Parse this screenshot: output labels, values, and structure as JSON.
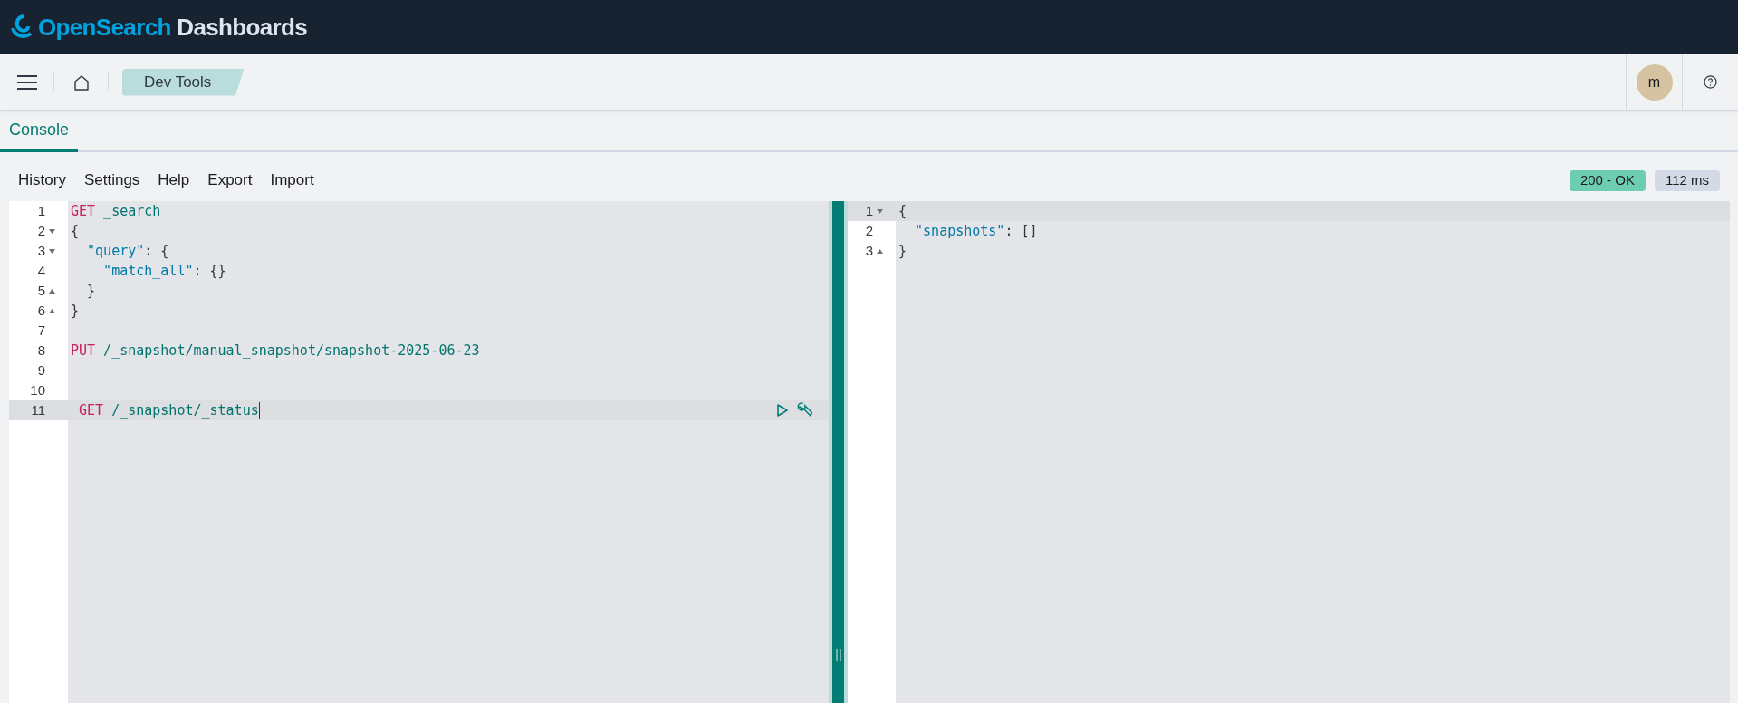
{
  "header": {
    "brand_primary": "OpenSearch",
    "brand_secondary": "Dashboards"
  },
  "nav": {
    "breadcrumb": "Dev Tools",
    "avatar": "m"
  },
  "tabs": [
    {
      "label": "Console",
      "selected": true
    }
  ],
  "menu": [
    "History",
    "Settings",
    "Help",
    "Export",
    "Import"
  ],
  "status": {
    "code": "200 - OK",
    "time": "112 ms"
  },
  "request_editor": {
    "lines": [
      {
        "number": "1",
        "fold_start": false,
        "fold_end": false,
        "active": false,
        "tokens": [
          {
            "kind": "method",
            "text": "GET"
          },
          {
            "kind": "path",
            "text": " _search"
          }
        ]
      },
      {
        "number": "2",
        "fold_start": true,
        "fold_end": false,
        "active": false,
        "tokens": [
          {
            "kind": "punct",
            "text": "{"
          }
        ]
      },
      {
        "number": "3",
        "fold_start": true,
        "fold_end": false,
        "active": false,
        "tokens": [
          {
            "kind": "key",
            "text": "  \"query\""
          },
          {
            "kind": "punct",
            "text": ": {"
          }
        ]
      },
      {
        "number": "4",
        "fold_start": false,
        "fold_end": false,
        "active": false,
        "tokens": [
          {
            "kind": "key",
            "text": "    \"match_all\""
          },
          {
            "kind": "punct",
            "text": ": {}"
          }
        ]
      },
      {
        "number": "5",
        "fold_start": false,
        "fold_end": true,
        "active": false,
        "tokens": [
          {
            "kind": "punct",
            "text": "  }"
          }
        ]
      },
      {
        "number": "6",
        "fold_start": false,
        "fold_end": true,
        "active": false,
        "tokens": [
          {
            "kind": "punct",
            "text": "}"
          }
        ]
      },
      {
        "number": "7",
        "fold_start": false,
        "fold_end": false,
        "active": false
      },
      {
        "number": "8",
        "fold_start": false,
        "fold_end": false,
        "active": false,
        "tokens": [
          {
            "kind": "method",
            "text": "PUT"
          },
          {
            "kind": "path",
            "text": " /_snapshot/manual_snapshot/snapshot-2025-06-23"
          }
        ]
      },
      {
        "number": "9",
        "fold_start": false,
        "fold_end": false,
        "active": false
      },
      {
        "number": "10",
        "fold_start": false,
        "fold_end": false,
        "active": false
      },
      {
        "number": "11",
        "fold_start": false,
        "fold_end": false,
        "active": true,
        "tokens": [
          {
            "kind": "method",
            "text": " GET"
          },
          {
            "kind": "path",
            "text": " /_snapshot/_status"
          }
        ]
      }
    ]
  },
  "response_editor": {
    "lines": [
      {
        "number": "1",
        "fold_start": true,
        "fold_end": false,
        "active": true,
        "tokens": [
          {
            "kind": "punct",
            "text": "{"
          }
        ]
      },
      {
        "number": "2",
        "fold_start": false,
        "fold_end": false,
        "active": false,
        "tokens": [
          {
            "kind": "key",
            "text": "  \"snapshots\""
          },
          {
            "kind": "punct",
            "text": ": []"
          }
        ]
      },
      {
        "number": "3",
        "fold_start": false,
        "fold_end": true,
        "active": false,
        "tokens": [
          {
            "kind": "punct",
            "text": "}"
          }
        ]
      }
    ]
  }
}
